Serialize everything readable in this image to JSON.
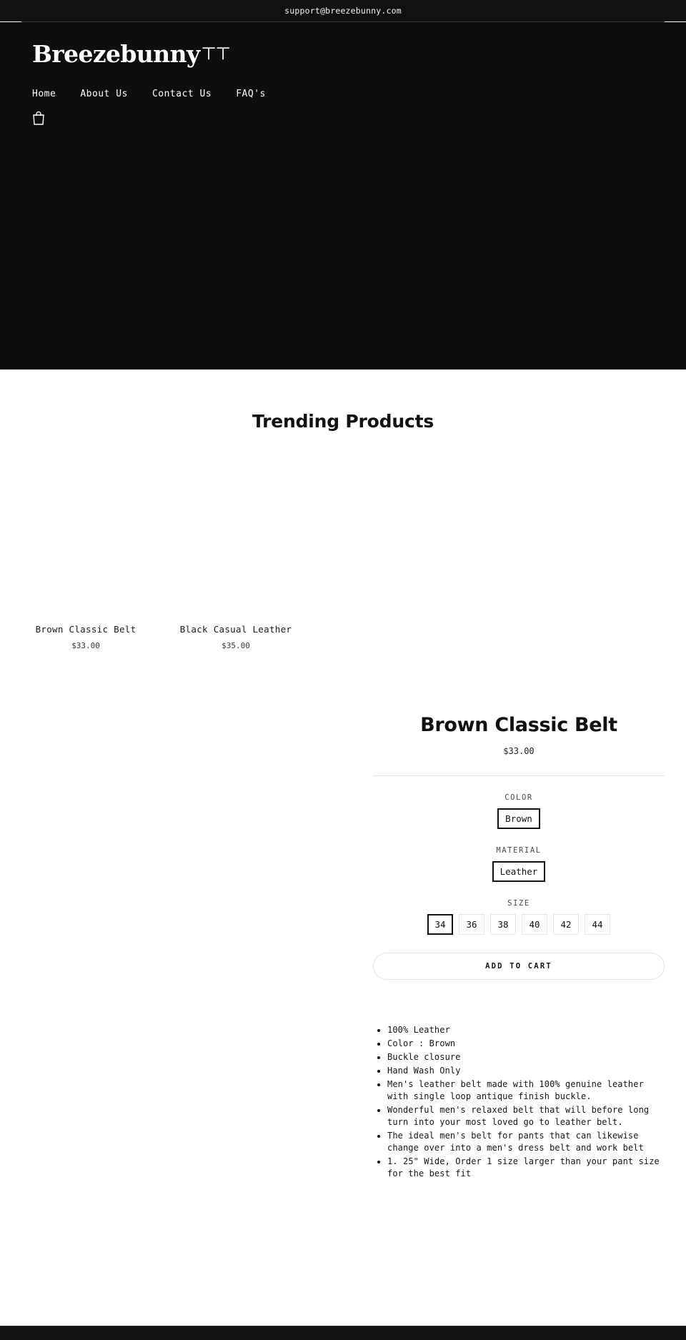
{
  "topbar": {
    "email": "support@breezebunny.com"
  },
  "header": {
    "logo_text": "Breezebunny",
    "logo_mark": "ㄒㄒ",
    "nav": [
      {
        "label": "Home"
      },
      {
        "label": "About Us"
      },
      {
        "label": "Contact Us"
      },
      {
        "label": "FAQ's"
      }
    ],
    "cart_icon": "shopping-bag-icon"
  },
  "trending": {
    "title": "Trending Products",
    "products": [
      {
        "name": "Brown Classic Belt",
        "price": "$33.00"
      },
      {
        "name": "Black Casual Leather",
        "price": "$35.00"
      }
    ]
  },
  "detail": {
    "title": "Brown Classic Belt",
    "price": "$33.00",
    "options": [
      {
        "label": "COLOR",
        "values": [
          {
            "label": "Brown",
            "selected": true
          }
        ]
      },
      {
        "label": "MATERIAL",
        "values": [
          {
            "label": "Leather",
            "selected": true
          }
        ]
      },
      {
        "label": "SIZE",
        "values": [
          {
            "label": "34",
            "selected": true
          },
          {
            "label": "36",
            "selected": false
          },
          {
            "label": "38",
            "selected": false
          },
          {
            "label": "40",
            "selected": false
          },
          {
            "label": "42",
            "selected": false
          },
          {
            "label": "44",
            "selected": false
          }
        ]
      }
    ],
    "add_to_cart_label": "ADD TO CART",
    "description_bullets": [
      "100% Leather",
      "Color : Brown",
      "Buckle closure",
      "Hand Wash Only",
      "Men's leather belt made with 100% genuine leather with single loop antique finish buckle.",
      "Wonderful men's relaxed belt that will before long turn into your most loved go to leather belt.",
      "The ideal men's belt for pants that can likewise change over into a men's dress belt and work belt",
      " 1. 25\" Wide, Order 1 size larger than your pant size for the best fit"
    ]
  },
  "colors": {
    "dark": "#111111",
    "hero_bg": "#0e0e0e",
    "page_bg": "#ffffff",
    "border_light": "#e6e6e6",
    "selected_border": "#111111"
  }
}
